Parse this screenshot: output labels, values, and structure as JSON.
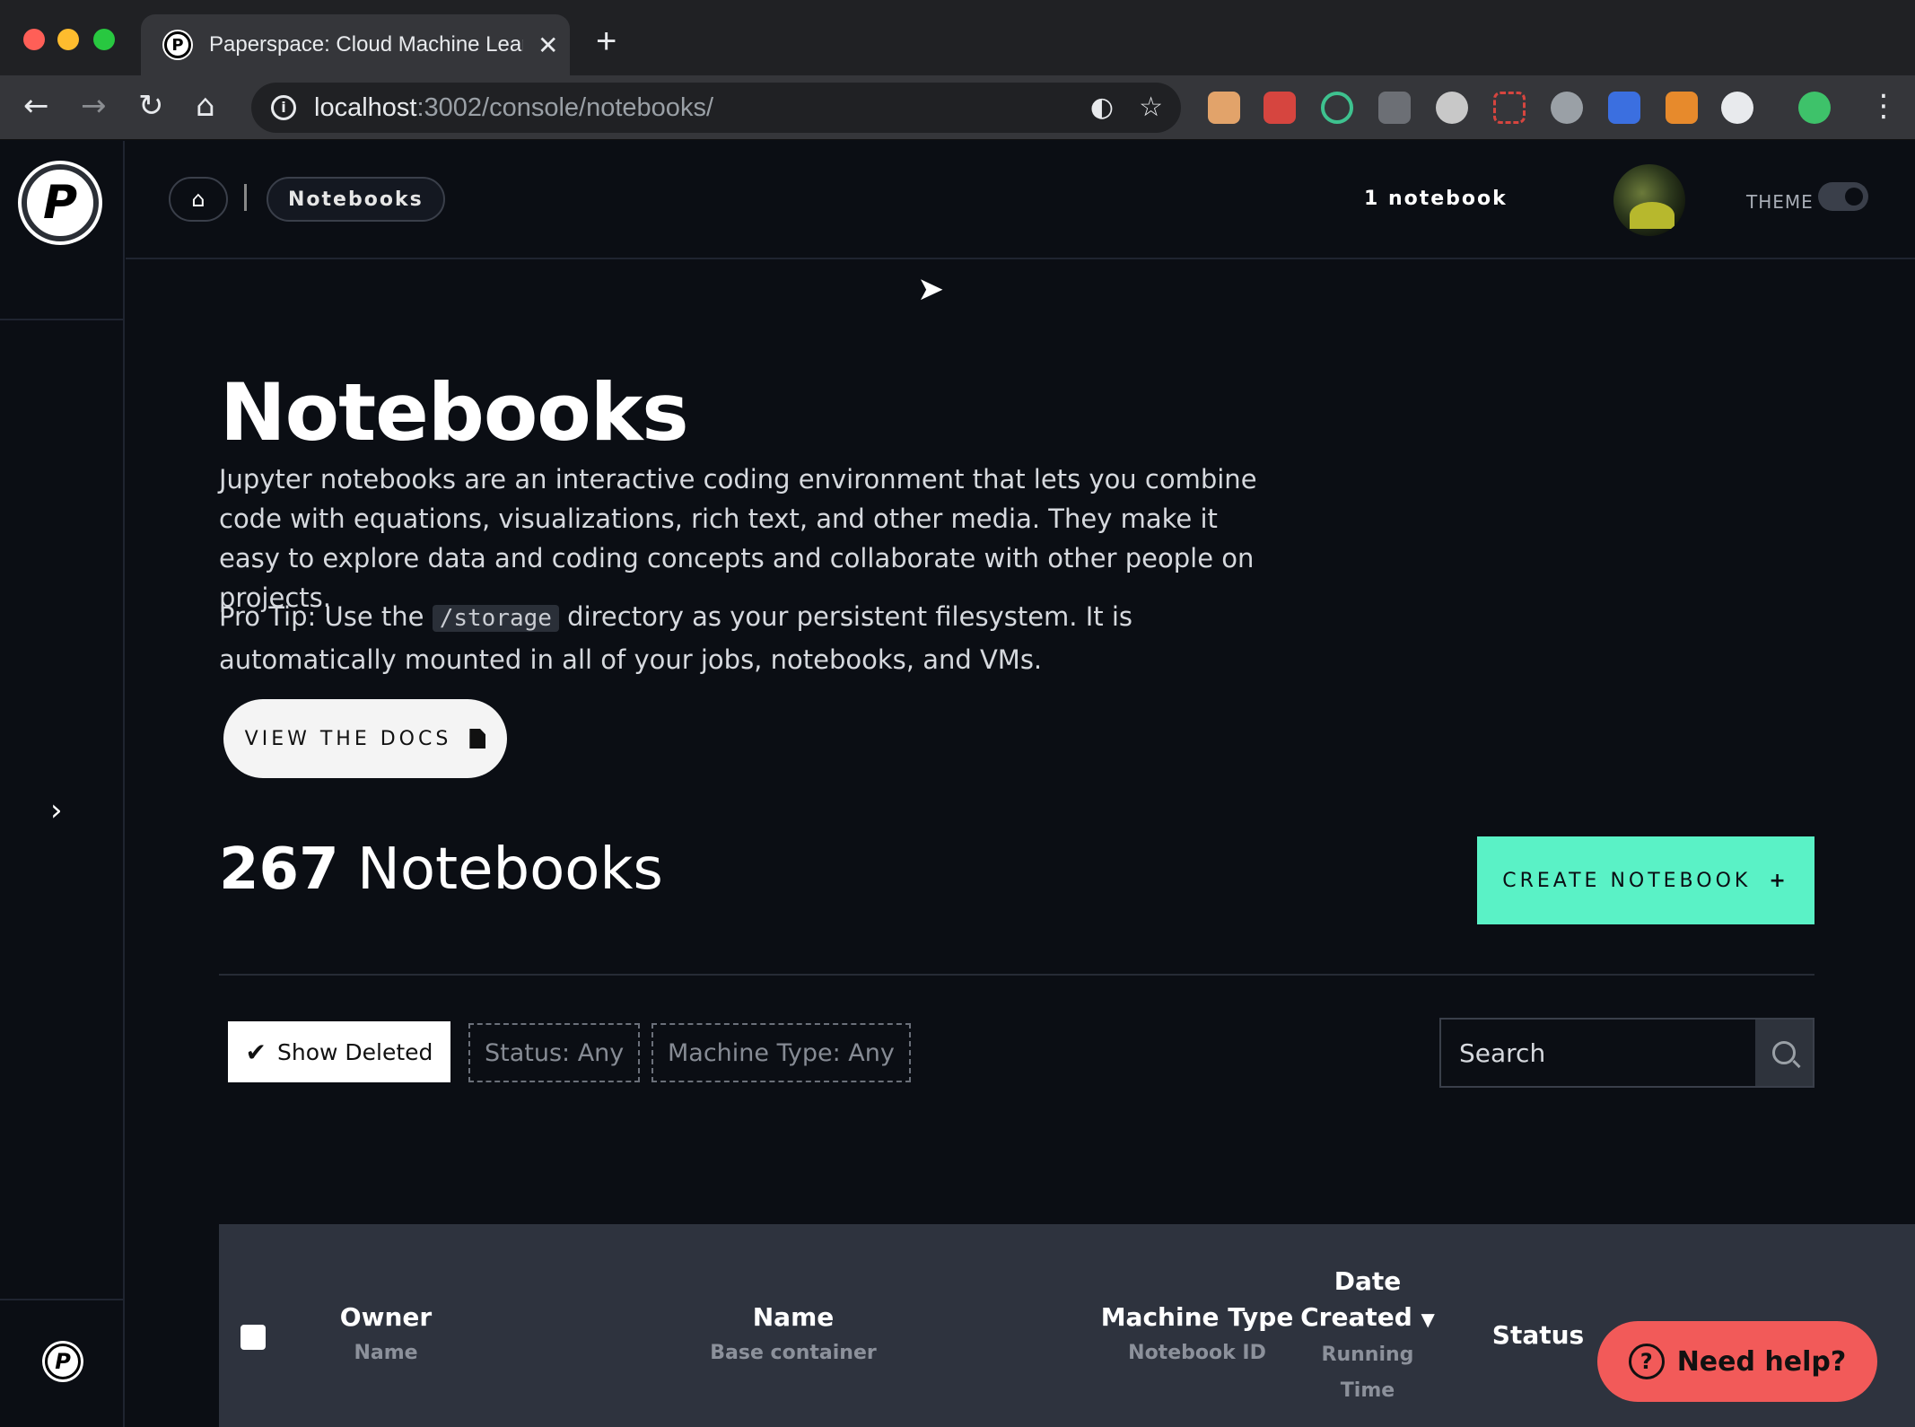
{
  "browser": {
    "tab_title": "Paperspace: Cloud Machine Lear",
    "url_host": "localhost",
    "url_path": ":3002/console/notebooks/",
    "traffic_colors": [
      "#ff5f57",
      "#febc2e",
      "#28c840"
    ]
  },
  "header": {
    "breadcrumb": "Notebooks",
    "notebook_count": "1 notebook",
    "theme_label": "THEME"
  },
  "page": {
    "title": "Notebooks",
    "description": "Jupyter notebooks are an interactive coding environment that lets you combine code with equations, visualizations, rich text, and other media. They make it easy to explore data and coding concepts and collaborate with other people on projects.",
    "tip_before": "Pro Tip: Use the ",
    "tip_code": "/storage",
    "tip_after": " directory as your persistent filesystem. It is automatically mounted in all of your jobs, notebooks, and VMs.",
    "docs_button": "VIEW THE DOCS",
    "count_number": "267",
    "count_label": "Notebooks",
    "create_button": "CREATE NOTEBOOK",
    "create_plus": "+"
  },
  "filters": {
    "show_deleted": "Show Deleted",
    "status": "Status: Any",
    "machine_type": "Machine Type: Any",
    "search_placeholder": "Search"
  },
  "table": {
    "owner": "Owner",
    "owner_sub": "Name",
    "name": "Name",
    "name_sub": "Base container",
    "machine_type": "Machine Type",
    "machine_type_sub": "Notebook ID",
    "date_line1": "Date",
    "date_line2": "Created",
    "date_sub1": "Running",
    "date_sub2": "Time",
    "status": "Status"
  },
  "help": {
    "label": "Need help?"
  },
  "colors": {
    "accent": "#5af2c6",
    "help": "#f25a59",
    "background": "#0b0e14"
  }
}
